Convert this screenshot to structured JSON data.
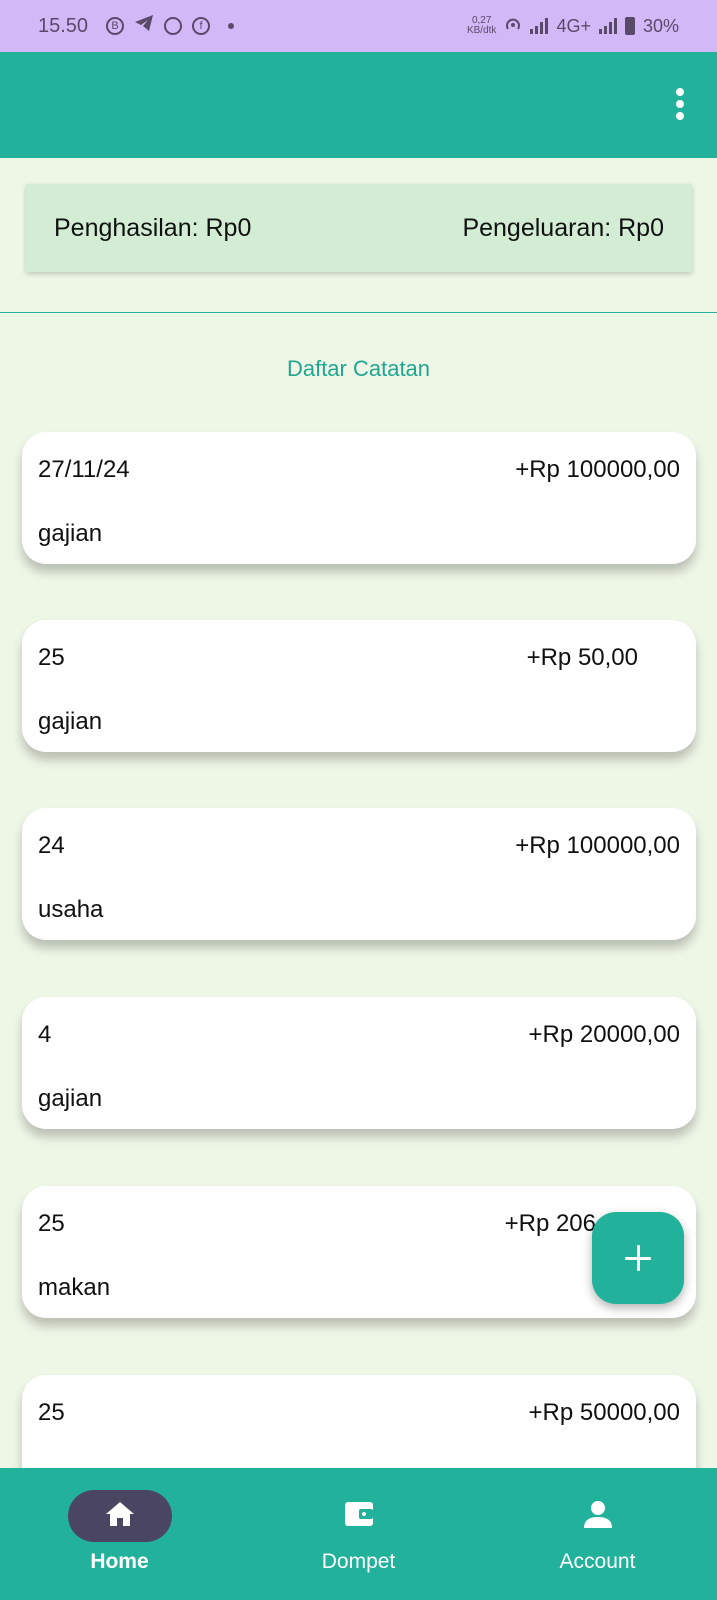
{
  "status_bar": {
    "time": "15.50",
    "speed_value": "0,27",
    "speed_unit": "KB/dtk",
    "network": "4G+",
    "battery": "30%"
  },
  "summary": {
    "income": "Penghasilan: Rp0",
    "expense": "Pengeluaran: Rp0"
  },
  "list_title": "Daftar Catatan",
  "records": [
    {
      "date": "27/11/24",
      "amount": "+Rp 100000,00",
      "category": "gajian"
    },
    {
      "date": "25",
      "amount": "+Rp 50,00",
      "category": "gajian"
    },
    {
      "date": "24",
      "amount": "+Rp 100000,00",
      "category": "usaha"
    },
    {
      "date": "4",
      "amount": "+Rp 20000,00",
      "category": "gajian"
    },
    {
      "date": "25",
      "amount": "+Rp 206",
      "category": "makan"
    },
    {
      "date": "25",
      "amount": "+Rp 50000,00",
      "category": ""
    }
  ],
  "nav": {
    "home": "Home",
    "wallet": "Dompet",
    "account": "Account"
  },
  "colors": {
    "primary": "#22b29c",
    "background": "#eef6e6",
    "summary_bg": "#d3edd4",
    "status_bar": "#d3b8f7",
    "active_pill": "#4a4560"
  }
}
